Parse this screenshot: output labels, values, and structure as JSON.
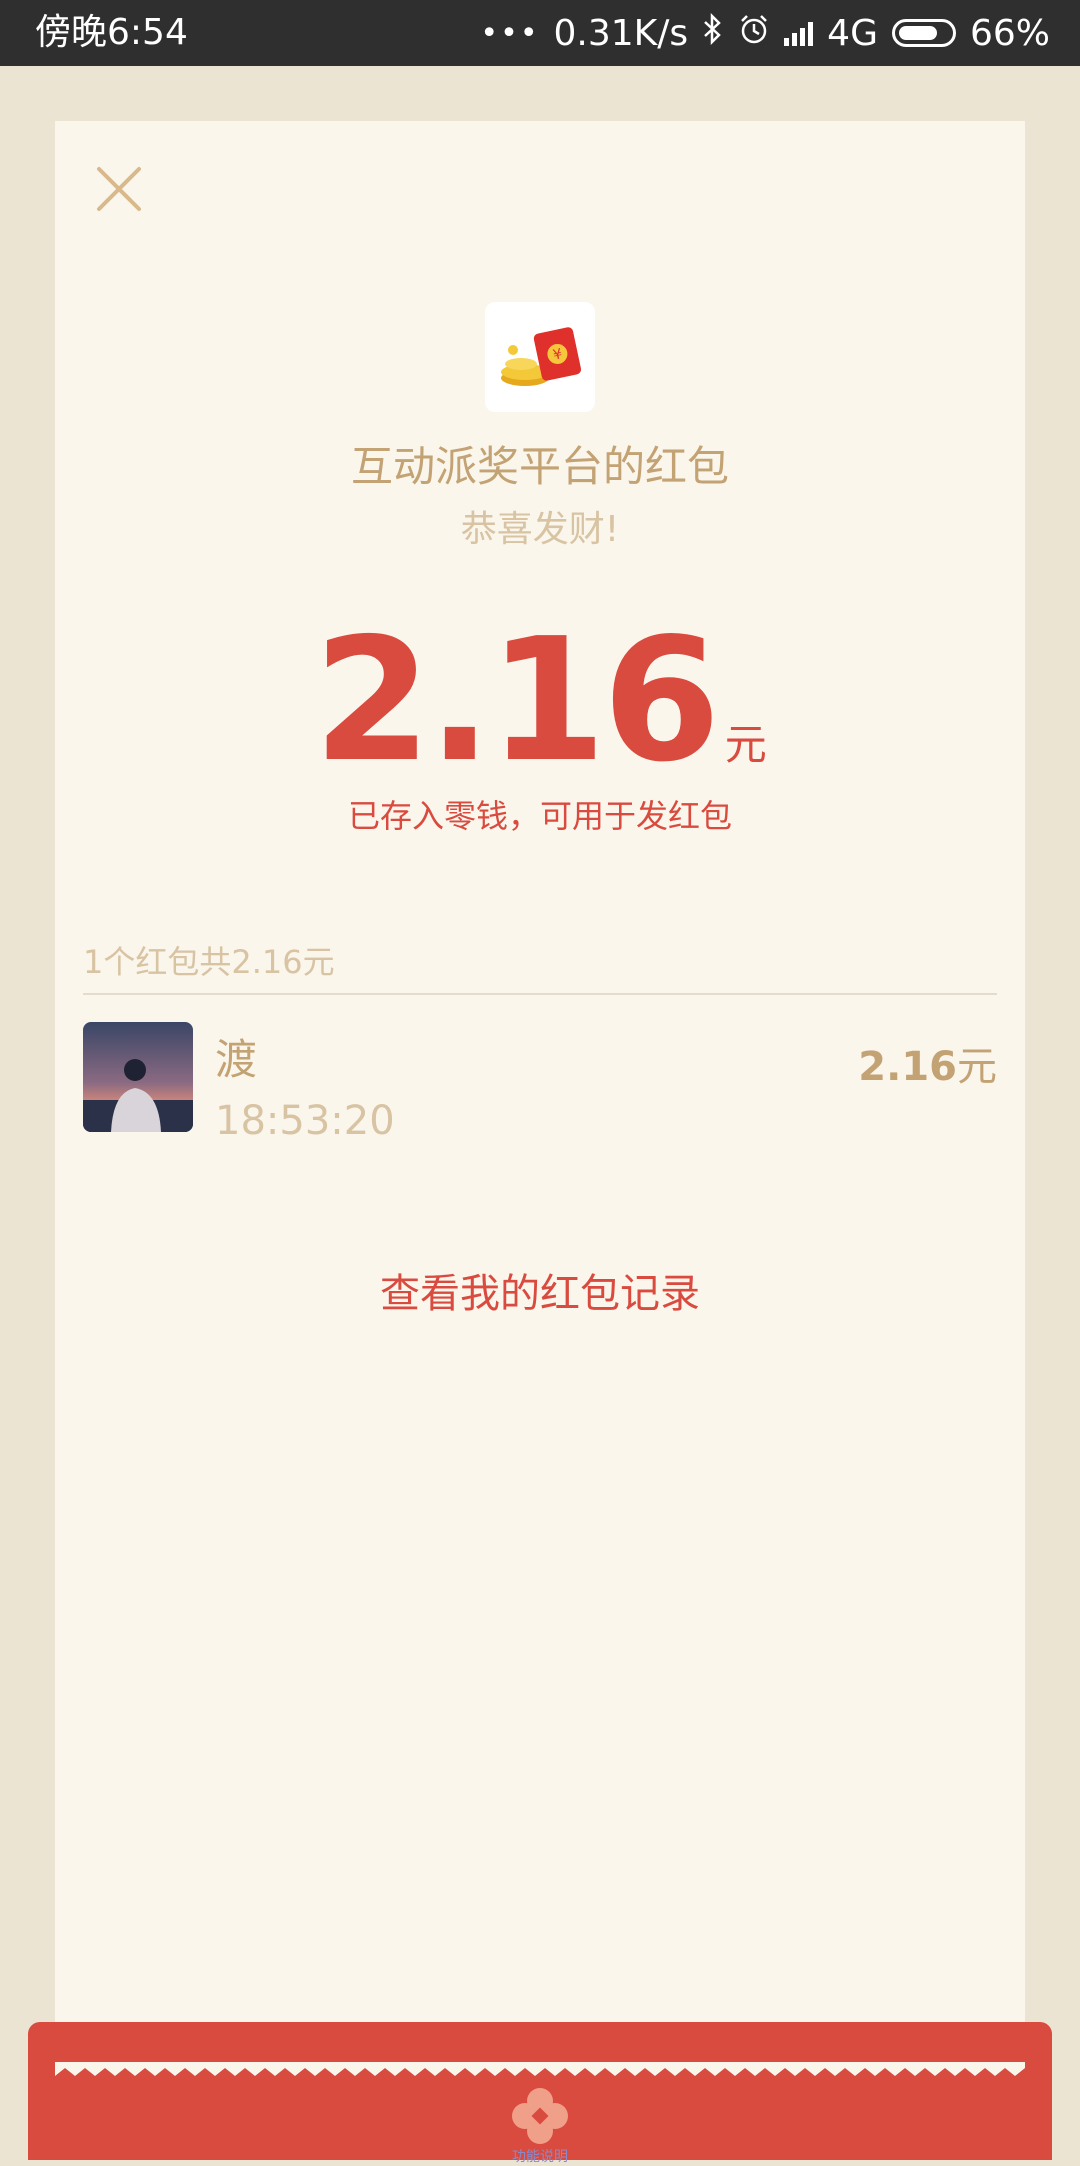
{
  "status_bar": {
    "time": "傍晚6:54",
    "dots": "•••",
    "net_speed": "0.31K/s",
    "network": "4G",
    "battery": "66%"
  },
  "dialog": {
    "title": "互动派奖平台的红包",
    "blessing": "恭喜发财!",
    "amount": "2.16",
    "amount_unit": "元",
    "saved_note": "已存入零钱，可用于发红包",
    "summary": "1个红包共2.16元",
    "records_link": "查看我的红包记录"
  },
  "recipients": [
    {
      "name": "渡",
      "time": "18:53:20",
      "amount": "2.16",
      "unit": "元"
    }
  ],
  "footer": {
    "label": "功能说明"
  },
  "colors": {
    "accent_red": "#d94a3f",
    "gold": "#c3a274",
    "muted_gold": "#d8c3a3",
    "card_bg": "#faf6ec",
    "page_bg": "#ece4d2"
  },
  "icons": [
    "close-icon",
    "red-packet-logo-icon",
    "flower-icon",
    "bluetooth-icon",
    "alarm-icon",
    "signal-icon",
    "battery-icon"
  ]
}
